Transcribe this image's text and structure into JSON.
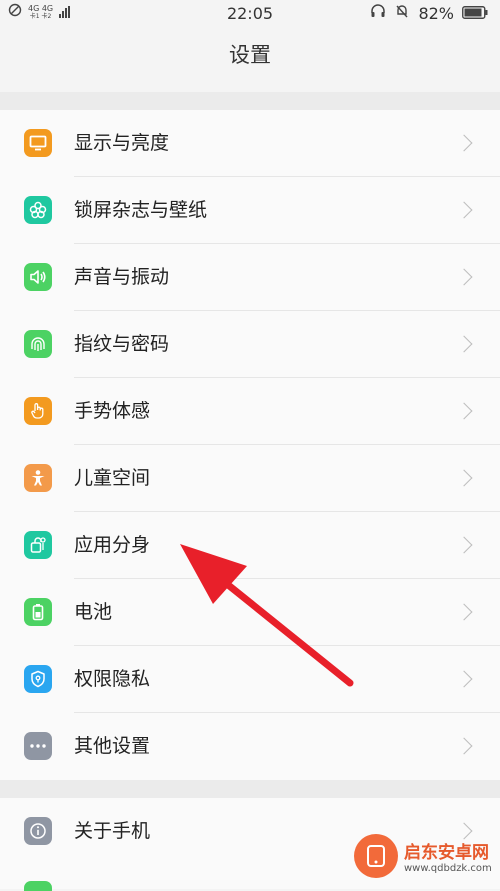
{
  "status_bar": {
    "network_top": "4G 4G",
    "network_sub": "卡1 卡2",
    "time": "22:05",
    "battery": "82%"
  },
  "header": {
    "title": "设置"
  },
  "groups": [
    {
      "items": [
        {
          "label": "显示与亮度",
          "icon": "display-icon",
          "color": "#f39a1f"
        },
        {
          "label": "锁屏杂志与壁纸",
          "icon": "flower-icon",
          "color": "#1fc8a0"
        },
        {
          "label": "声音与振动",
          "icon": "speaker-icon",
          "color": "#4cd263"
        },
        {
          "label": "指纹与密码",
          "icon": "fingerprint-icon",
          "color": "#4cd263"
        },
        {
          "label": "手势体感",
          "icon": "hand-icon",
          "color": "#f39a1f"
        },
        {
          "label": "儿童空间",
          "icon": "child-icon",
          "color": "#f39a4a"
        },
        {
          "label": "应用分身",
          "icon": "app-clone-icon",
          "color": "#1fc8a0"
        },
        {
          "label": "电池",
          "icon": "battery-icon",
          "color": "#4cd263"
        },
        {
          "label": "权限隐私",
          "icon": "shield-icon",
          "color": "#2aa6f0"
        },
        {
          "label": "其他设置",
          "icon": "more-icon",
          "color": "#8f96a3"
        }
      ]
    },
    {
      "items": [
        {
          "label": "关于手机",
          "icon": "info-icon",
          "color": "#8f96a3"
        }
      ]
    }
  ],
  "watermark": {
    "title": "启东安卓网",
    "url": "www.qdbdzk.com"
  },
  "colors": {
    "background": "#f4f4f4",
    "row_bg": "#fafafa",
    "arrow": "#e8202a"
  }
}
